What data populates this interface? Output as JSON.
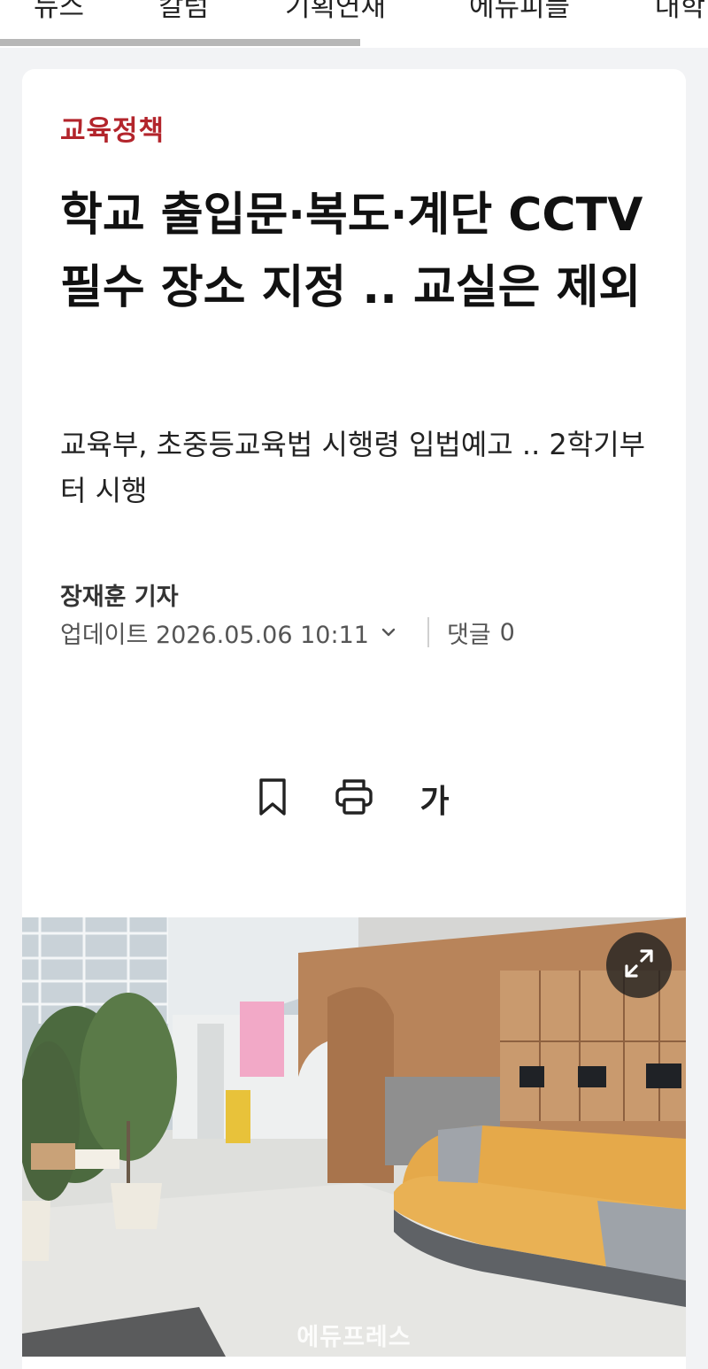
{
  "nav": {
    "tabs": [
      "뉴스",
      "칼럼",
      "기획연재",
      "에듀피플",
      "대학"
    ]
  },
  "article": {
    "category": "교육정책",
    "headline": "학교 출입문·복도·계단 CCTV 필수 장소 지정 .. 교실은 제외",
    "subheadline": "교육부, 초중등교육법 시행령 입법예고 .. 2학기부터 시행",
    "author": "장재훈 기자",
    "updated": "업데이트 2026.05.06 10:11",
    "comments_label": "댓글",
    "comments_count": "0",
    "font_size_label": "가"
  },
  "photo": {
    "watermark": "에듀프레스"
  },
  "colors": {
    "category": "#b3252c",
    "background": "#f2f3f5",
    "card": "#ffffff"
  },
  "icons": {
    "bookmark": "bookmark-icon",
    "print": "printer-icon",
    "expand": "expand-icon",
    "chevron": "chevron-down-icon"
  }
}
